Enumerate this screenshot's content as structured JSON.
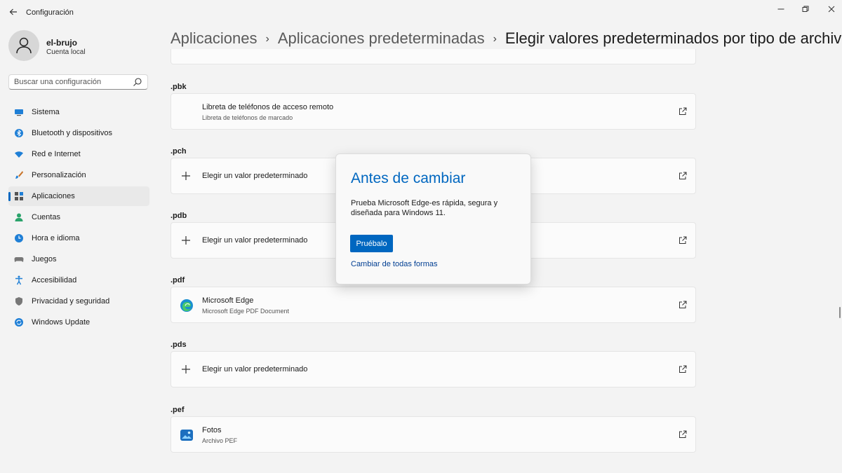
{
  "window": {
    "title": "Configuración"
  },
  "user": {
    "name": "el-brujo",
    "account": "Cuenta local"
  },
  "search": {
    "placeholder": "Buscar una configuración"
  },
  "sidebar": {
    "items": [
      {
        "label": "Sistema",
        "icon": "monitor-icon",
        "active": false
      },
      {
        "label": "Bluetooth y dispositivos",
        "icon": "bluetooth-icon",
        "active": false
      },
      {
        "label": "Red e Internet",
        "icon": "wifi-icon",
        "active": false
      },
      {
        "label": "Personalización",
        "icon": "brush-icon",
        "active": false
      },
      {
        "label": "Aplicaciones",
        "icon": "apps-icon",
        "active": true
      },
      {
        "label": "Cuentas",
        "icon": "person-icon",
        "active": false
      },
      {
        "label": "Hora e idioma",
        "icon": "globe-clock-icon",
        "active": false
      },
      {
        "label": "Juegos",
        "icon": "gamepad-icon",
        "active": false
      },
      {
        "label": "Accesibilidad",
        "icon": "accessibility-icon",
        "active": false
      },
      {
        "label": "Privacidad y seguridad",
        "icon": "shield-icon",
        "active": false
      },
      {
        "label": "Windows Update",
        "icon": "update-icon",
        "active": false
      }
    ]
  },
  "breadcrumb": {
    "items": [
      "Aplicaciones",
      "Aplicaciones predeterminadas",
      "Elegir valores predeterminados por tipo de archivo"
    ],
    "separator": "›"
  },
  "filetypes": [
    {
      "ext": ".pbk",
      "title": "Libreta de teléfonos de acceso remoto",
      "subtitle": "Libreta de teléfonos de marcado",
      "icon": "none"
    },
    {
      "ext": ".pch",
      "title": "Elegir un valor predeterminado",
      "subtitle": "",
      "icon": "plus-icon"
    },
    {
      "ext": ".pdb",
      "title": "Elegir un valor predeterminado",
      "subtitle": "",
      "icon": "plus-icon"
    },
    {
      "ext": ".pdf",
      "title": "Microsoft Edge",
      "subtitle": "Microsoft Edge PDF Document",
      "icon": "edge-icon"
    },
    {
      "ext": ".pds",
      "title": "Elegir un valor predeterminado",
      "subtitle": "",
      "icon": "plus-icon"
    },
    {
      "ext": ".pef",
      "title": "Fotos",
      "subtitle": "Archivo PEF",
      "icon": "photos-icon"
    }
  ],
  "dialog": {
    "title": "Antes de cambiar",
    "body": "Prueba Microsoft Edge-es rápida, segura y diseñada para Windows 11.",
    "primary_button": "Pruébalo",
    "link": "Cambiar de todas formas"
  },
  "colors": {
    "accent": "#0067c0",
    "background": "#f3f3f3",
    "card": "#fbfbfb"
  }
}
